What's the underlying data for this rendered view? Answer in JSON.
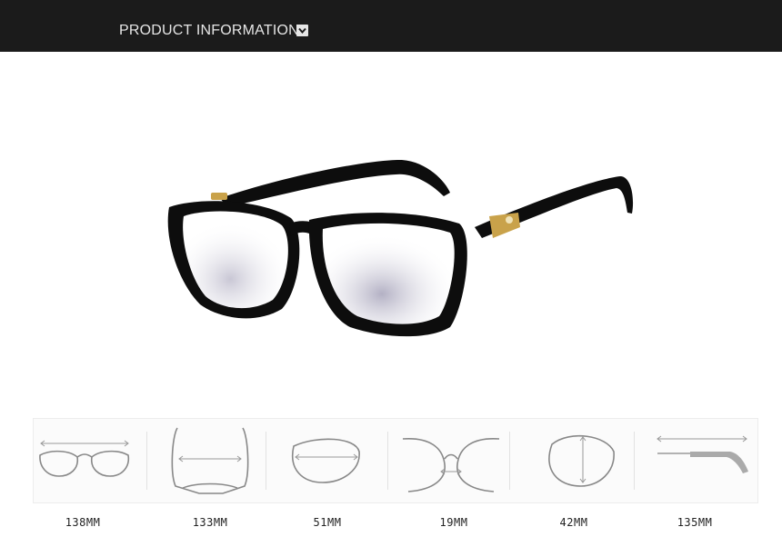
{
  "header": {
    "title": "PRODUCT INFORMATION",
    "background": "#1b1b1b",
    "text_color": "#e6e6e6"
  },
  "product": {
    "icon": "eyeglasses-photo",
    "frame_color": "#0d0d0d",
    "hinge_color": "#c9a24a"
  },
  "measurements": [
    {
      "icon": "frame-width-icon",
      "value": "138MM"
    },
    {
      "icon": "frame-top-width-icon",
      "value": "133MM"
    },
    {
      "icon": "lens-width-icon",
      "value": "51MM"
    },
    {
      "icon": "bridge-width-icon",
      "value": "19MM"
    },
    {
      "icon": "lens-height-icon",
      "value": "42MM"
    },
    {
      "icon": "temple-length-icon",
      "value": "135MM"
    }
  ]
}
